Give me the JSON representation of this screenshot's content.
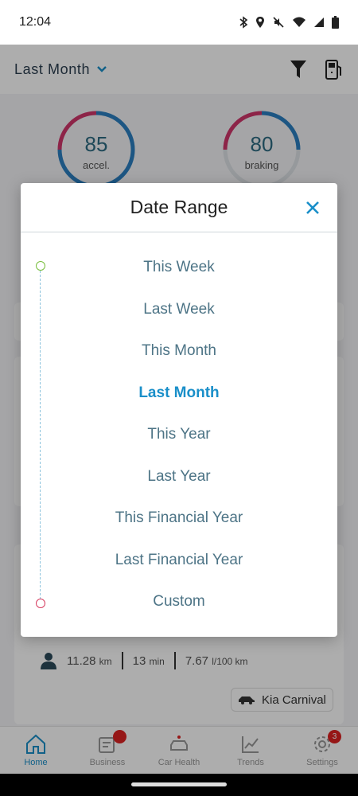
{
  "status_bar": {
    "time": "12:04"
  },
  "header": {
    "period_label": "Last Month"
  },
  "scores": [
    {
      "value": "85",
      "label": "accel."
    },
    {
      "value": "80",
      "label": "braking"
    }
  ],
  "trip": {
    "distance": "11.28",
    "distance_unit": "km",
    "duration": "13",
    "duration_unit": "min",
    "consumption": "7.67",
    "consumption_unit": "l/100 km",
    "vehicle": "Kia Carnival"
  },
  "nav": [
    {
      "label": "Home"
    },
    {
      "label": "Business"
    },
    {
      "label": "Car Health"
    },
    {
      "label": "Trends"
    },
    {
      "label": "Settings",
      "badge": "3"
    }
  ],
  "dialog": {
    "title": "Date Range",
    "options": [
      {
        "label": "This Week"
      },
      {
        "label": "Last Week"
      },
      {
        "label": "This Month"
      },
      {
        "label": "Last Month",
        "selected": true
      },
      {
        "label": "This Year"
      },
      {
        "label": "Last Year"
      },
      {
        "label": "This Financial Year"
      },
      {
        "label": "Last Financial Year"
      },
      {
        "label": "Custom"
      }
    ]
  },
  "colors": {
    "accent": "#1a8fc9",
    "option_text": "#4d7486",
    "timeline_start": "#78be3c",
    "timeline_end": "#d63a5e"
  }
}
